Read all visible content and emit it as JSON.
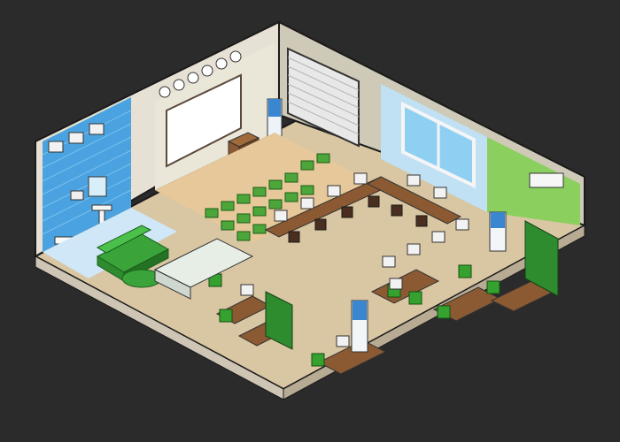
{
  "scene": {
    "kind": "isometric pixel-art office interior",
    "background_color": "#2b2b2b",
    "palette": {
      "wall_left": "#e6e1d4",
      "wall_top": "#ffffff",
      "floor_wood": "#e6c89a",
      "floor_carpet": "#e8d4ad",
      "floor_tile": "#cfe7f7",
      "floor_tile_line": "#a8cce6",
      "bath_wall": "#4aa3e0",
      "class_wall": "#cfc9b8",
      "sky_wall": "#bfe1f3",
      "green_wall": "#8bcf5e",
      "accent_green": "#2e8b2e",
      "desk_brown": "#8b5a32",
      "monitor": "#f2f2f2",
      "cooler_blue": "#3a86d0"
    },
    "rooms": [
      "bathroom",
      "lobby",
      "lecture-room",
      "computer-lab",
      "open-office",
      "reception"
    ],
    "clock_count": 6
  }
}
